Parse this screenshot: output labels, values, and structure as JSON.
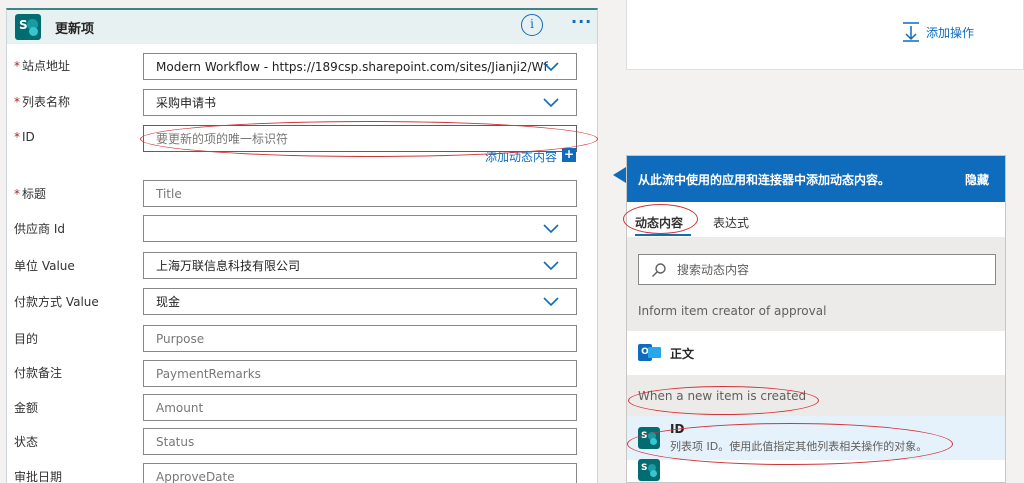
{
  "card": {
    "title": "更新项",
    "fields": [
      {
        "label": "站点地址",
        "required": true,
        "value": "Modern Workflow - https://189csp.sharepoint.com/sites/Jianji2/Wf",
        "dropdown": true
      },
      {
        "label": "列表名称",
        "required": true,
        "value": "采购申请书",
        "dropdown": true
      },
      {
        "label": "ID",
        "required": true,
        "placeholder": "要更新的项的唯一标识符",
        "dropdown": false
      },
      {
        "label": "标题",
        "required": true,
        "placeholder": "Title",
        "dropdown": false
      },
      {
        "label": "供应商 Id",
        "required": false,
        "value": "",
        "dropdown": true
      },
      {
        "label": "单位 Value",
        "required": false,
        "value": "上海万联信息科技有限公司",
        "dropdown": true
      },
      {
        "label": "付款方式 Value",
        "required": false,
        "value": "现金",
        "dropdown": true
      },
      {
        "label": "目的",
        "required": false,
        "placeholder": "Purpose",
        "dropdown": false
      },
      {
        "label": "付款备注",
        "required": false,
        "placeholder": "PaymentRemarks",
        "dropdown": false
      },
      {
        "label": "金额",
        "required": false,
        "placeholder": "Amount",
        "dropdown": false
      },
      {
        "label": "状态",
        "required": false,
        "placeholder": "Status",
        "dropdown": false
      },
      {
        "label": "审批日期",
        "required": false,
        "placeholder": "ApproveDate",
        "dropdown": false
      }
    ],
    "add_dynamic_label": "添加动态内容",
    "add_dynamic_plus": "+"
  },
  "top_panel": {
    "add_action_label": "添加操作"
  },
  "dynamic_panel": {
    "header": "从此流中使用的应用和连接器中添加动态内容。",
    "hide_label": "隐藏",
    "tabs": [
      "动态内容",
      "表达式"
    ],
    "search_placeholder": "搜索动态内容",
    "sections": [
      {
        "title": "Inform item creator of approval",
        "items": [
          {
            "title": "正文",
            "icon": "outlook-icon"
          }
        ]
      },
      {
        "title": "When a new item is created",
        "items": [
          {
            "title": "ID",
            "description": "列表项 ID。使用此值指定其他列表相关操作的对象。",
            "icon": "sharepoint-icon"
          }
        ]
      }
    ]
  },
  "colors": {
    "accent": "#0f6cbd",
    "sharepoint": "#036c70",
    "annotation": "#d13438",
    "required": "#a4262c"
  }
}
